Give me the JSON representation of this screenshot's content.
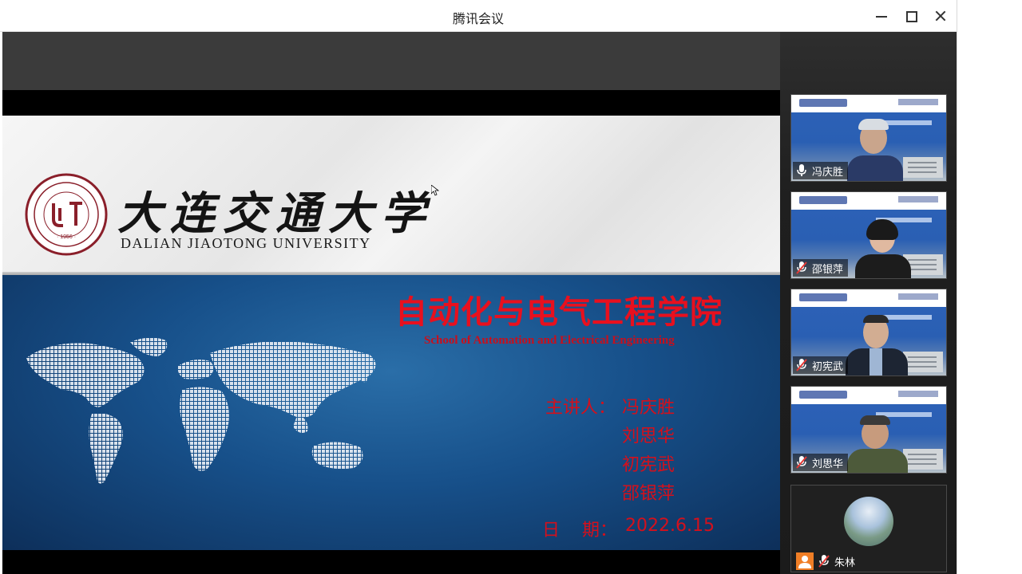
{
  "window": {
    "title": "腾讯会议"
  },
  "slide": {
    "university_cn": "大连交通大学",
    "university_en": "DALIAN JIAOTONG UNIVERSITY",
    "seal_year": "· 1956 ·",
    "college_cn": "自动化与电气工程学院",
    "college_en": "School of Automation and Electrical  Engineering",
    "presenter_label": "主讲人：",
    "presenters": [
      "冯庆胜",
      "刘思华",
      "初宪武",
      "邵银萍"
    ],
    "date_label": "日    期：",
    "date_value": "2022.6.15"
  },
  "participants": [
    {
      "name": "冯庆胜",
      "mic": "on",
      "video": "on"
    },
    {
      "name": "邵银萍",
      "mic": "muted",
      "video": "on"
    },
    {
      "name": "初宪武",
      "mic": "muted",
      "video": "on"
    },
    {
      "name": "刘思华",
      "mic": "muted",
      "video": "on"
    },
    {
      "name": "朱林",
      "mic": "muted",
      "video": "off"
    }
  ],
  "icons": {
    "minimize": "minimize-icon",
    "maximize": "maximize-icon",
    "close": "close-icon",
    "mic": "mic-icon",
    "mic_muted": "mic-muted-icon",
    "user": "user-icon"
  },
  "colors": {
    "title_red": "#e8101e",
    "slide_blue": "#17508a",
    "user_icon_orange": "#f07e26"
  }
}
